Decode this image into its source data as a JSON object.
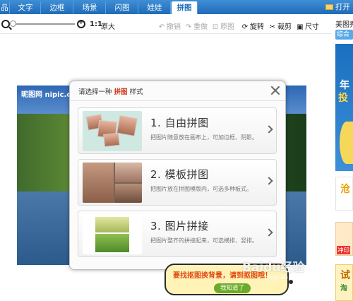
{
  "tabs": [
    {
      "label": "品"
    },
    {
      "label": "文字"
    },
    {
      "label": "边框"
    },
    {
      "label": "场景"
    },
    {
      "label": "闪图"
    },
    {
      "label": "娃娃"
    },
    {
      "label": "拼图",
      "active": true
    }
  ],
  "open_button": "打开",
  "toolbar": {
    "zoom_ratio": "1:1",
    "original_size": "原大",
    "undo": "撤销",
    "redo": "重做",
    "original": "原图",
    "rotate": "旋转",
    "crop": "裁剪",
    "size": "尺寸"
  },
  "canvas": {
    "watermark": "昵图网 nipic.com"
  },
  "right_panel": {
    "title": "美图秀秀",
    "button": "综合",
    "ad1_line1": "年",
    "ad1_line2": "投",
    "ad2": "沧",
    "ad3_label": "冲印",
    "ad4": "试",
    "ad4_sub": "淘"
  },
  "dialog": {
    "title_prefix": "请选择一种",
    "title_highlight": "拼图",
    "title_suffix": "样式",
    "options": [
      {
        "name": "1. 自由拼图",
        "desc": "把图片随意放在画布上，可加边框、阴影。"
      },
      {
        "name": "2. 模板拼图",
        "desc": "把图片放在拼图模版内，可选多种板式。"
      },
      {
        "name": "3. 图片拼接",
        "desc": "把图片整齐的拼接起来，可选横排、竖排。"
      }
    ]
  },
  "bubble": {
    "text": "要找抠图换背景，请到抠图哦！",
    "button": "我知道了"
  },
  "watermark": {
    "main": "Baidu经验",
    "sub": "jingyan.baidu.com"
  },
  "colors": {
    "tab_blue": "#1f6cb8",
    "highlight_red": "#d23a1e",
    "bubble_bg": "#fff3b8",
    "bubble_btn": "#6cab2a"
  }
}
